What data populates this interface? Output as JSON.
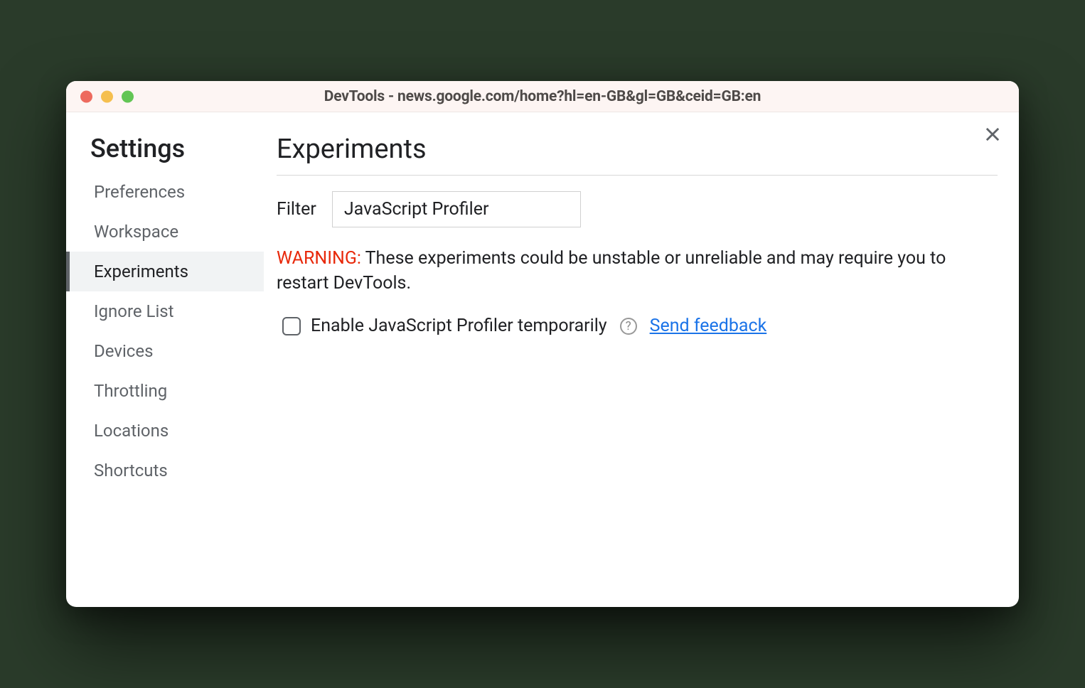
{
  "window": {
    "title": "DevTools - news.google.com/home?hl=en-GB&gl=GB&ceid=GB:en"
  },
  "sidebar": {
    "title": "Settings",
    "items": [
      {
        "label": "Preferences",
        "active": false
      },
      {
        "label": "Workspace",
        "active": false
      },
      {
        "label": "Experiments",
        "active": true
      },
      {
        "label": "Ignore List",
        "active": false
      },
      {
        "label": "Devices",
        "active": false
      },
      {
        "label": "Throttling",
        "active": false
      },
      {
        "label": "Locations",
        "active": false
      },
      {
        "label": "Shortcuts",
        "active": false
      }
    ]
  },
  "main": {
    "title": "Experiments",
    "filter_label": "Filter",
    "filter_value": "JavaScript Profiler",
    "warning_prefix": "WARNING:",
    "warning_text": " These experiments could be unstable or unreliable and may require you to restart DevTools.",
    "experiment": {
      "label": "Enable JavaScript Profiler temporarily",
      "help": "?",
      "feedback": "Send feedback",
      "checked": false
    }
  }
}
